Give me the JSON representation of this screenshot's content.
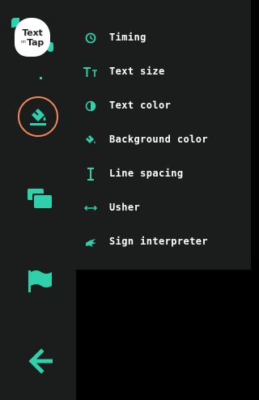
{
  "logo": {
    "line1": "Text",
    "small": "on",
    "line2": "Tap"
  },
  "rail": {
    "items": [
      {
        "icon": "paint-bucket-icon",
        "active": true,
        "accent": "#f0885a"
      },
      {
        "icon": "screens-icon"
      },
      {
        "icon": "flag-icon"
      },
      {
        "icon": "arrow-left-icon"
      }
    ]
  },
  "menu": {
    "items": [
      {
        "label": "Timing",
        "icon": "clock-icon"
      },
      {
        "label": "Text size",
        "icon": "text-size-icon"
      },
      {
        "label": "Text color",
        "icon": "contrast-icon"
      },
      {
        "label": "Background color",
        "icon": "paint-bucket-icon"
      },
      {
        "label": "Line spacing",
        "icon": "line-spacing-icon"
      },
      {
        "label": "Usher",
        "icon": "double-arrow-icon"
      },
      {
        "label": "Sign interpreter",
        "icon": "sign-hand-icon"
      }
    ]
  },
  "colors": {
    "accent": "#2fd1ad",
    "active_ring": "#f0885a",
    "panel": "#1b1c1c",
    "background": "#000000"
  }
}
